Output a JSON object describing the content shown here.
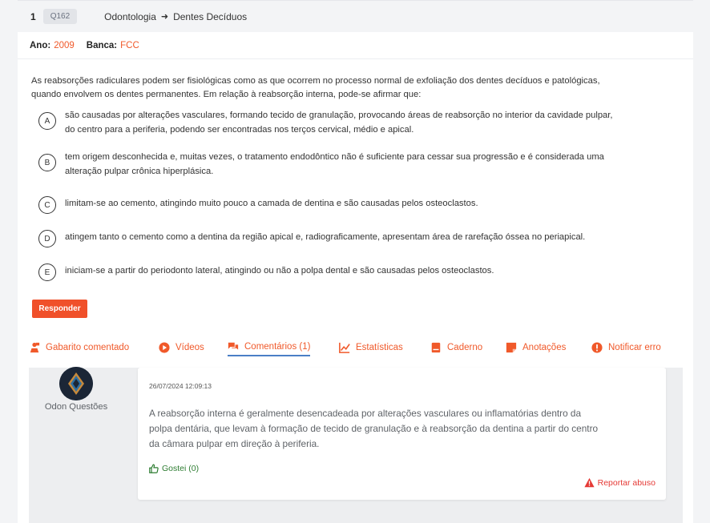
{
  "question": {
    "number": "1",
    "code": "Q162",
    "subject": "Odontologia",
    "topic": "Dentes Decíduos",
    "year_label": "Ano:",
    "year": "2009",
    "board_label": "Banca:",
    "board": "FCC",
    "statement_line1": "As reabsorções radiculares podem ser fisiológicas como as que ocorrem no processo normal de exfoliação dos dentes decíduos e patológicas,",
    "statement_line2": "quando envolvem os dentes permanentes. Em relação à reabsorção interna, pode-se afirmar que:",
    "options": [
      {
        "letter": "A",
        "line1": "são causadas por alterações vasculares, formando tecido de granulação, provocando áreas de reabsorção no interior da cavidade pulpar,",
        "line2": "do centro para a periferia, podendo ser encontradas nos terços cervical, médio e apical."
      },
      {
        "letter": "B",
        "line1": "tem origem desconhecida e, muitas vezes, o tratamento endodôntico não é suficiente para cessar sua progressão e é considerada uma",
        "line2": "alteração pulpar crônica hiperplásica."
      },
      {
        "letter": "C",
        "line1": "limitam-se ao cemento, atingindo muito pouco a camada de dentina e são causadas pelos osteoclastos.",
        "line2": ""
      },
      {
        "letter": "D",
        "line1": "atingem tanto o cemento como a dentina da região apical e, radiograficamente, apresentam área de rarefação óssea no periapical.",
        "line2": ""
      },
      {
        "letter": "E",
        "line1": "iniciam-se a partir do periodonto lateral, atingindo ou não a polpa dental e são causadas pelos osteoclastos.",
        "line2": ""
      }
    ],
    "answer_button": "Responder"
  },
  "tabs": [
    {
      "label": "Gabarito comentado",
      "icon": "teacher-icon"
    },
    {
      "label": "Vídeos",
      "icon": "play-icon"
    },
    {
      "label": "Comentários (1)",
      "icon": "comments-icon"
    },
    {
      "label": "Estatísticas",
      "icon": "chart-line-icon"
    },
    {
      "label": "Caderno",
      "icon": "notebook-icon"
    },
    {
      "label": "Anotações",
      "icon": "sticky-note-icon"
    },
    {
      "label": "Notificar erro",
      "icon": "exclamation-icon"
    }
  ],
  "comment": {
    "author": "Odon Questões",
    "date": "26/07/2024 12:09:13",
    "text_line1": "A reabsorção interna é geralmente desencadeada por alterações vasculares ou inflamatórias dentro da",
    "text_line2": "polpa dentária, que levam à formação de tecido de granulação e à reabsorção da dentina a partir do centro",
    "text_line3": "da câmara pulpar em direção à periferia.",
    "like_label": "Gostei (0)",
    "report_label": "Reportar abuso"
  },
  "colors": {
    "accent": "#f0592a",
    "tab_underline": "#4a7fc6",
    "like": "#2e7d32",
    "report": "#e53935"
  }
}
